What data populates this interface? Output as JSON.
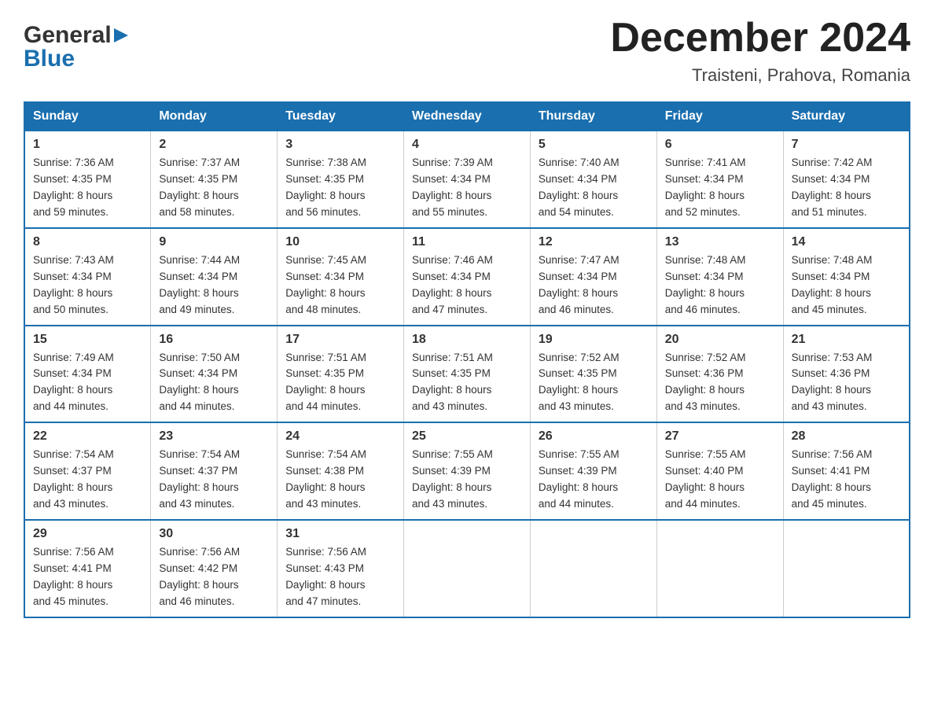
{
  "header": {
    "logo": {
      "general": "General",
      "blue": "Blue"
    },
    "title": "December 2024",
    "location": "Traisteni, Prahova, Romania"
  },
  "weekdays": [
    "Sunday",
    "Monday",
    "Tuesday",
    "Wednesday",
    "Thursday",
    "Friday",
    "Saturday"
  ],
  "weeks": [
    [
      {
        "day": "1",
        "sunrise": "7:36 AM",
        "sunset": "4:35 PM",
        "daylight": "8 hours and 59 minutes."
      },
      {
        "day": "2",
        "sunrise": "7:37 AM",
        "sunset": "4:35 PM",
        "daylight": "8 hours and 58 minutes."
      },
      {
        "day": "3",
        "sunrise": "7:38 AM",
        "sunset": "4:35 PM",
        "daylight": "8 hours and 56 minutes."
      },
      {
        "day": "4",
        "sunrise": "7:39 AM",
        "sunset": "4:34 PM",
        "daylight": "8 hours and 55 minutes."
      },
      {
        "day": "5",
        "sunrise": "7:40 AM",
        "sunset": "4:34 PM",
        "daylight": "8 hours and 54 minutes."
      },
      {
        "day": "6",
        "sunrise": "7:41 AM",
        "sunset": "4:34 PM",
        "daylight": "8 hours and 52 minutes."
      },
      {
        "day": "7",
        "sunrise": "7:42 AM",
        "sunset": "4:34 PM",
        "daylight": "8 hours and 51 minutes."
      }
    ],
    [
      {
        "day": "8",
        "sunrise": "7:43 AM",
        "sunset": "4:34 PM",
        "daylight": "8 hours and 50 minutes."
      },
      {
        "day": "9",
        "sunrise": "7:44 AM",
        "sunset": "4:34 PM",
        "daylight": "8 hours and 49 minutes."
      },
      {
        "day": "10",
        "sunrise": "7:45 AM",
        "sunset": "4:34 PM",
        "daylight": "8 hours and 48 minutes."
      },
      {
        "day": "11",
        "sunrise": "7:46 AM",
        "sunset": "4:34 PM",
        "daylight": "8 hours and 47 minutes."
      },
      {
        "day": "12",
        "sunrise": "7:47 AM",
        "sunset": "4:34 PM",
        "daylight": "8 hours and 46 minutes."
      },
      {
        "day": "13",
        "sunrise": "7:48 AM",
        "sunset": "4:34 PM",
        "daylight": "8 hours and 46 minutes."
      },
      {
        "day": "14",
        "sunrise": "7:48 AM",
        "sunset": "4:34 PM",
        "daylight": "8 hours and 45 minutes."
      }
    ],
    [
      {
        "day": "15",
        "sunrise": "7:49 AM",
        "sunset": "4:34 PM",
        "daylight": "8 hours and 44 minutes."
      },
      {
        "day": "16",
        "sunrise": "7:50 AM",
        "sunset": "4:34 PM",
        "daylight": "8 hours and 44 minutes."
      },
      {
        "day": "17",
        "sunrise": "7:51 AM",
        "sunset": "4:35 PM",
        "daylight": "8 hours and 44 minutes."
      },
      {
        "day": "18",
        "sunrise": "7:51 AM",
        "sunset": "4:35 PM",
        "daylight": "8 hours and 43 minutes."
      },
      {
        "day": "19",
        "sunrise": "7:52 AM",
        "sunset": "4:35 PM",
        "daylight": "8 hours and 43 minutes."
      },
      {
        "day": "20",
        "sunrise": "7:52 AM",
        "sunset": "4:36 PM",
        "daylight": "8 hours and 43 minutes."
      },
      {
        "day": "21",
        "sunrise": "7:53 AM",
        "sunset": "4:36 PM",
        "daylight": "8 hours and 43 minutes."
      }
    ],
    [
      {
        "day": "22",
        "sunrise": "7:54 AM",
        "sunset": "4:37 PM",
        "daylight": "8 hours and 43 minutes."
      },
      {
        "day": "23",
        "sunrise": "7:54 AM",
        "sunset": "4:37 PM",
        "daylight": "8 hours and 43 minutes."
      },
      {
        "day": "24",
        "sunrise": "7:54 AM",
        "sunset": "4:38 PM",
        "daylight": "8 hours and 43 minutes."
      },
      {
        "day": "25",
        "sunrise": "7:55 AM",
        "sunset": "4:39 PM",
        "daylight": "8 hours and 43 minutes."
      },
      {
        "day": "26",
        "sunrise": "7:55 AM",
        "sunset": "4:39 PM",
        "daylight": "8 hours and 44 minutes."
      },
      {
        "day": "27",
        "sunrise": "7:55 AM",
        "sunset": "4:40 PM",
        "daylight": "8 hours and 44 minutes."
      },
      {
        "day": "28",
        "sunrise": "7:56 AM",
        "sunset": "4:41 PM",
        "daylight": "8 hours and 45 minutes."
      }
    ],
    [
      {
        "day": "29",
        "sunrise": "7:56 AM",
        "sunset": "4:41 PM",
        "daylight": "8 hours and 45 minutes."
      },
      {
        "day": "30",
        "sunrise": "7:56 AM",
        "sunset": "4:42 PM",
        "daylight": "8 hours and 46 minutes."
      },
      {
        "day": "31",
        "sunrise": "7:56 AM",
        "sunset": "4:43 PM",
        "daylight": "8 hours and 47 minutes."
      },
      null,
      null,
      null,
      null
    ]
  ],
  "labels": {
    "sunrise": "Sunrise:",
    "sunset": "Sunset:",
    "daylight": "Daylight:"
  }
}
